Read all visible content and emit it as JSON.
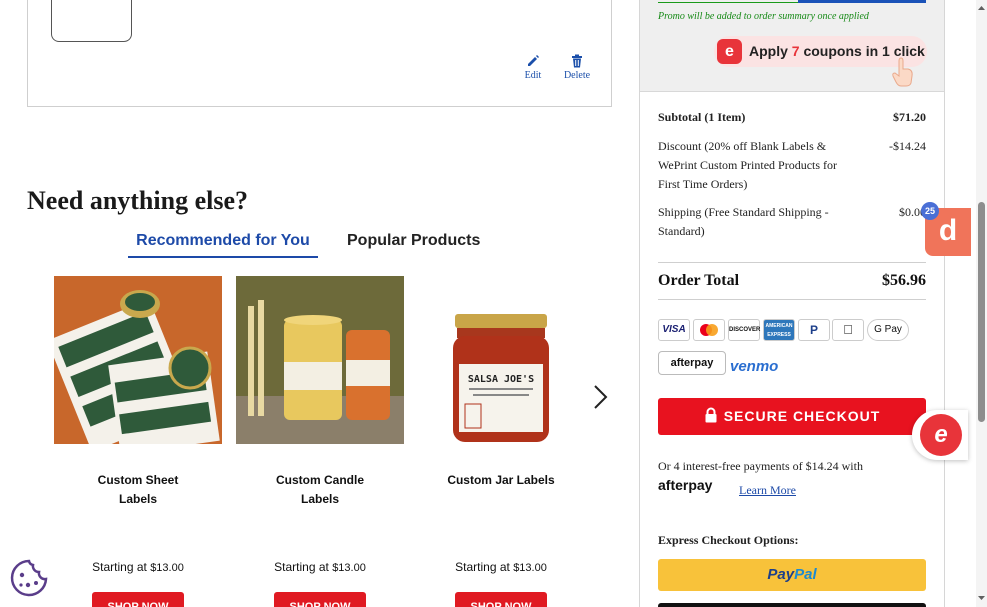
{
  "cart_item": {
    "edit_label": "Edit",
    "delete_label": "Delete"
  },
  "recommend": {
    "title": "Need anything else?",
    "tabs": [
      "Recommended for You",
      "Popular Products"
    ],
    "products": [
      {
        "name_line1": "Custom Sheet",
        "name_line2": "Labels",
        "price_prefix": "Starting at",
        "price": "$13.00",
        "cta": "SHOP NOW"
      },
      {
        "name_line1": "Custom Candle",
        "name_line2": "Labels",
        "price_prefix": "Starting at",
        "price": "$13.00",
        "cta": "SHOP NOW"
      },
      {
        "name_line1": "Custom Jar Labels",
        "name_line2": "",
        "price_prefix": "Starting at",
        "price": "$13.00",
        "cta": "SHOP NOW"
      }
    ],
    "jar_label_text": "SALSA JOE'S"
  },
  "summary": {
    "promo_note": "Promo will be added to order summary once applied",
    "coupon": {
      "pre": "Apply ",
      "count": "7",
      "post": " coupons in 1 click"
    },
    "subtotal_label": "Subtotal (1 Item)",
    "subtotal_value": "$71.20",
    "discount_label": "Discount (20% off Blank Labels & WePrint Custom Printed Products for First Time Orders)",
    "discount_value": "-$14.24",
    "shipping_label": "Shipping (Free Standard Shipping - Standard)",
    "shipping_value": "$0.00",
    "total_label": "Order Total",
    "total_value": "$56.96",
    "payment_methods": [
      "VISA",
      "Mastercard",
      "DISCOVER",
      "AMERICAN EXPRESS",
      "PayPal",
      "Apple Pay",
      "G Pay",
      "afterpay",
      "venmo"
    ],
    "secure_checkout": "SECURE CHECKOUT",
    "installment_text": "Or 4 interest-free payments of $14.24 with",
    "afterpay_logo": "afterpay",
    "learn_more": "Learn More",
    "express_title": "Express Checkout Options:",
    "paypal_pay": "Pay",
    "paypal_pal": "Pal"
  },
  "overlays": {
    "d_badge_letter": "d",
    "d_badge_count": "25",
    "c_letter": "e"
  },
  "colors": {
    "accent_blue": "#1d4aa8",
    "checkout_red": "#e8121f",
    "promo_green": "#178a17",
    "paypal_yellow": "#f8c23a"
  }
}
